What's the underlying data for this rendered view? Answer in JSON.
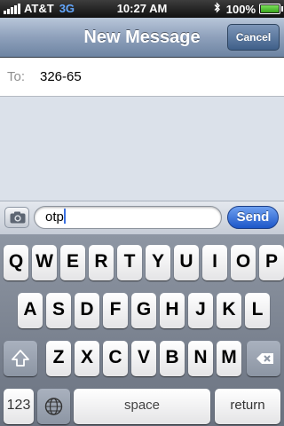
{
  "status_bar": {
    "carrier": "AT&T",
    "network": "3G",
    "time": "10:27 AM",
    "battery": "100%",
    "battery_level": 1.0,
    "signal_bars": 5
  },
  "nav": {
    "title": "New Message",
    "cancel_label": "Cancel"
  },
  "to_field": {
    "label": "To:",
    "value": "326-65"
  },
  "compose": {
    "text": "otp",
    "send_label": "Send"
  },
  "keyboard": {
    "row1": [
      "Q",
      "W",
      "E",
      "R",
      "T",
      "Y",
      "U",
      "I",
      "O",
      "P"
    ],
    "row2": [
      "A",
      "S",
      "D",
      "F",
      "G",
      "H",
      "J",
      "K",
      "L"
    ],
    "row3": [
      "Z",
      "X",
      "C",
      "V",
      "B",
      "N",
      "M"
    ],
    "numbers_label": "123",
    "space_label": "space",
    "return_label": "return"
  },
  "colors": {
    "nav_bar": "#8ea0bb",
    "send_button": "#1c56c8",
    "network_text": "#64a8ff",
    "thread_background": "#dbe1ea"
  },
  "icons": [
    "signal-icon",
    "bluetooth-icon",
    "battery-icon",
    "camera-icon",
    "shift-icon",
    "backspace-icon",
    "globe-icon"
  ]
}
